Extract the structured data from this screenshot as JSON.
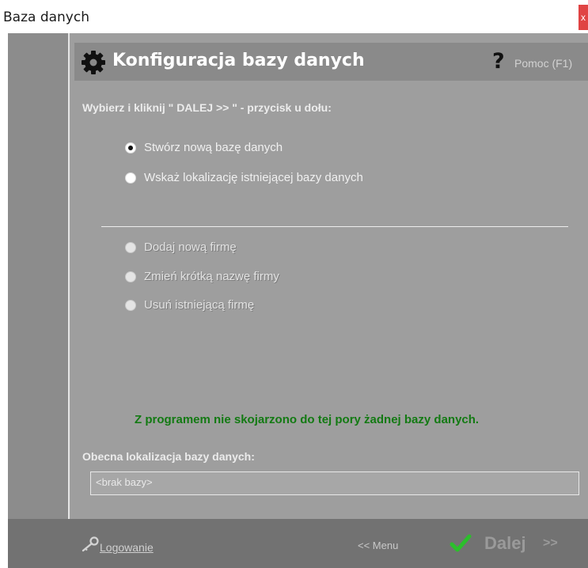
{
  "window": {
    "title": "Baza danych",
    "close_label": "x"
  },
  "header": {
    "title": "Konfiguracja bazy danych",
    "help_icon": "?",
    "help_label": "Pomoc (F1)",
    "icon": "gear-icon"
  },
  "instruction": "Wybierz i kliknij \" DALEJ >> \"   -   przycisk u dołu:",
  "db_options": [
    {
      "label": "Stwórz nową bazę danych",
      "checked": true,
      "enabled": true
    },
    {
      "label": "Wskaż lokalizację istniejącej bazy danych",
      "checked": false,
      "enabled": true
    }
  ],
  "company_options": [
    {
      "label": "Dodaj nową firmę",
      "checked": false,
      "enabled": false
    },
    {
      "label": "Zmień krótką nazwę firmy",
      "checked": false,
      "enabled": false
    },
    {
      "label": "Usuń istniejącą firmę",
      "checked": false,
      "enabled": false
    }
  ],
  "status_message": "Z programem nie skojarzono do tej pory żadnej bazy danych.",
  "location": {
    "label": "Obecna lokalizacja bazy danych:",
    "value": "<brak bazy>"
  },
  "footer": {
    "login_label": "Logowanie",
    "menu_label": "<<  Menu",
    "next_label": "Dalej",
    "next_arrows": ">>"
  },
  "colors": {
    "panel": "#9e9e9e",
    "header": "#8a8a8a",
    "footer": "#727272",
    "status_text": "#137a13",
    "check_icon": "#2bbf2b",
    "close_button": "#e04343"
  }
}
